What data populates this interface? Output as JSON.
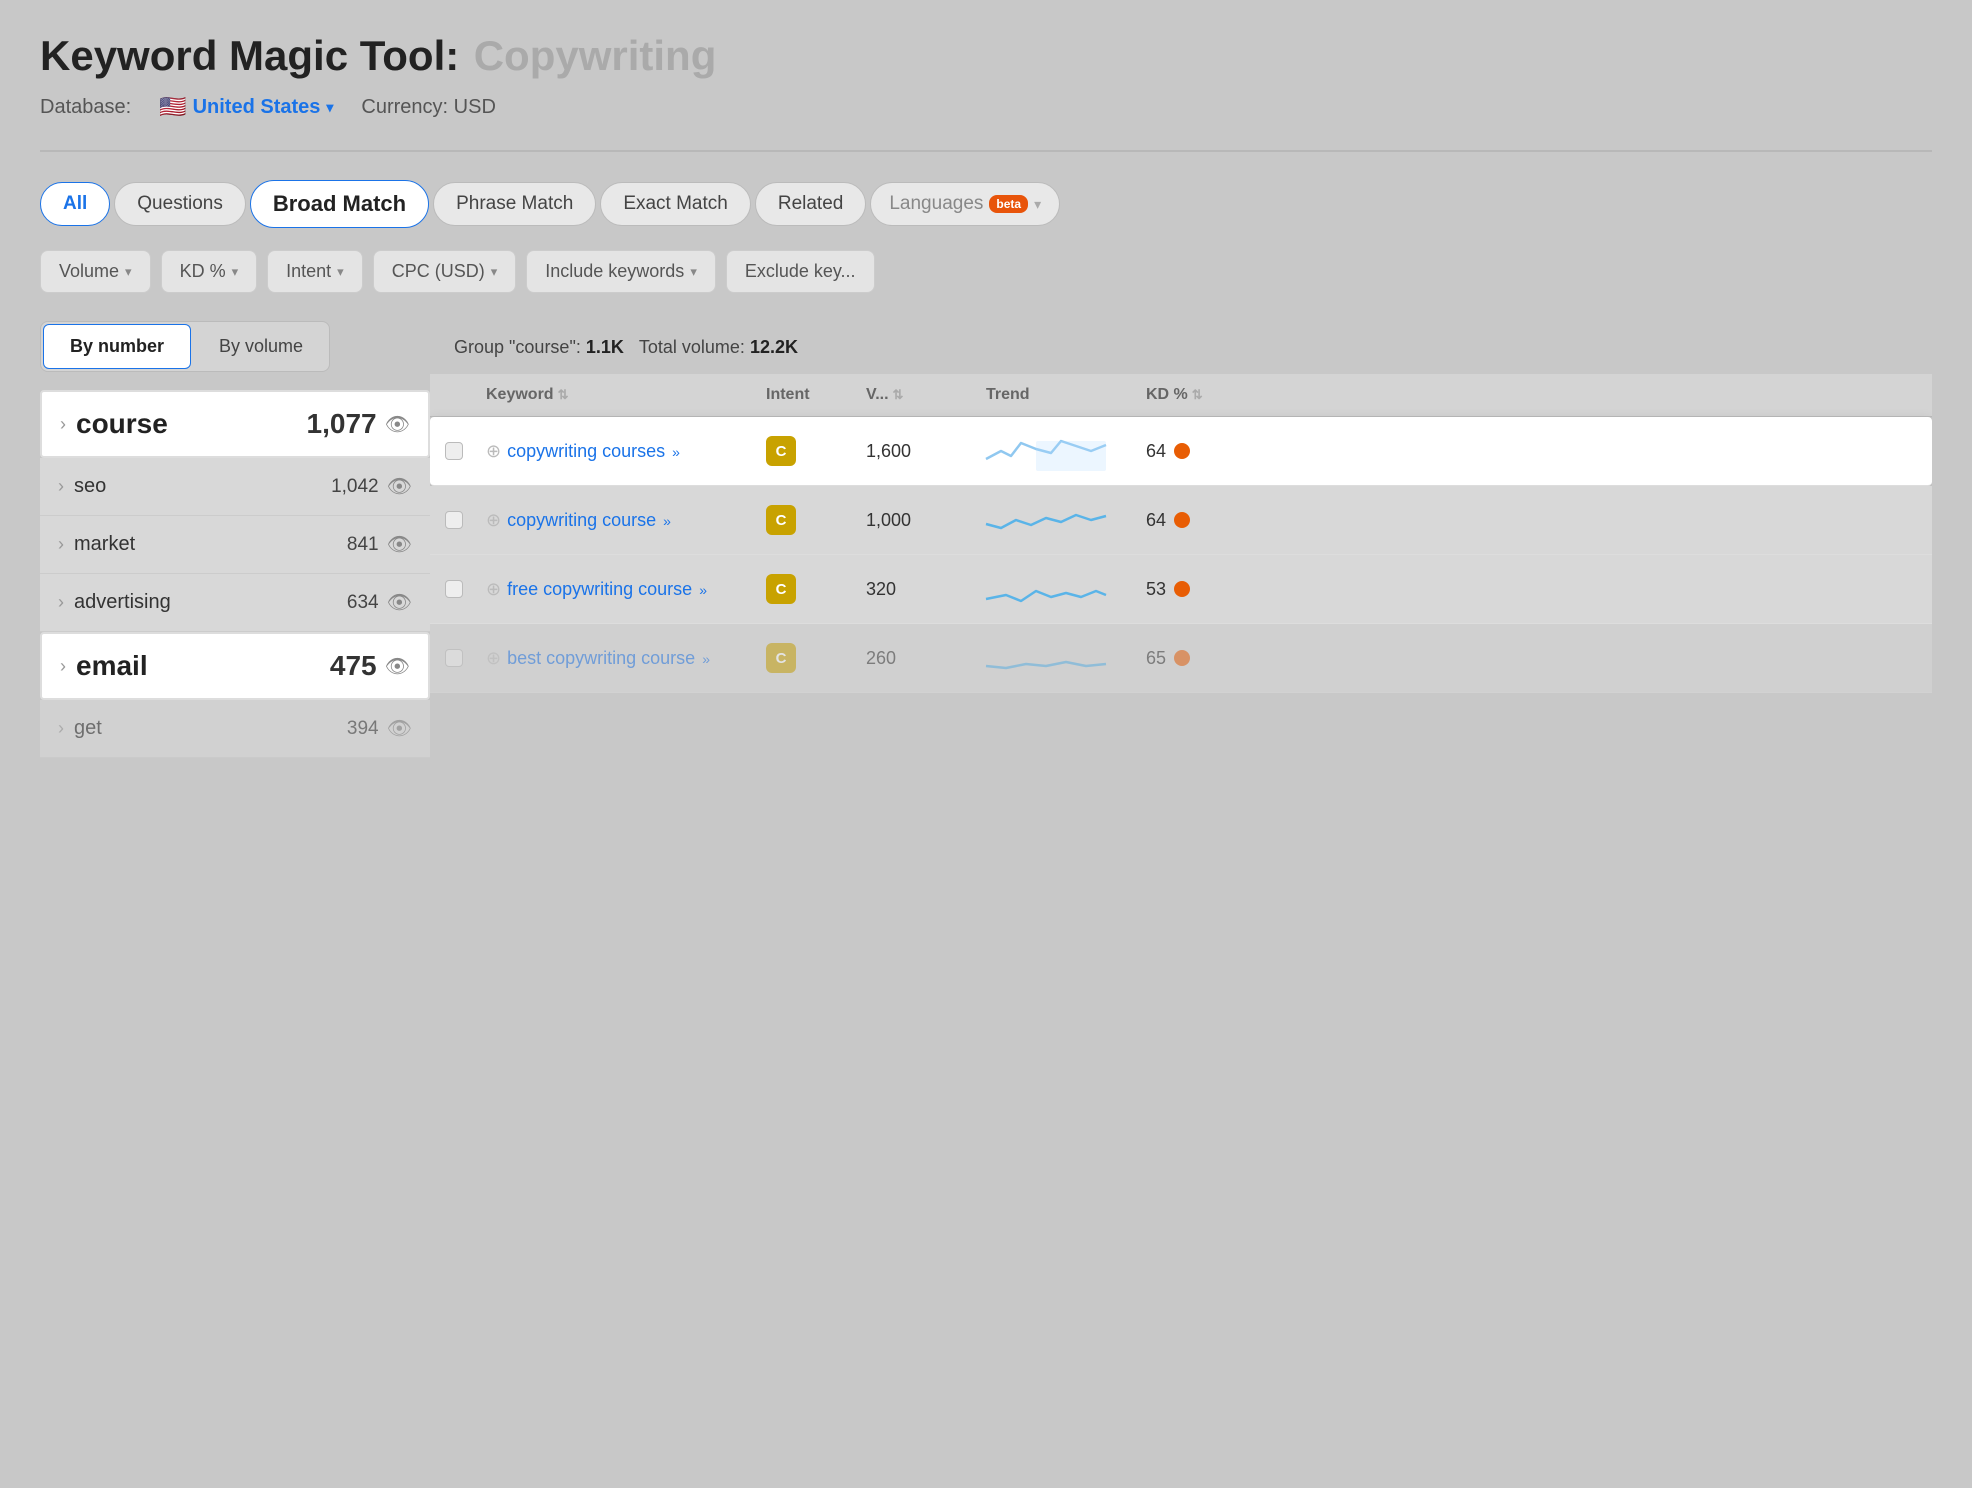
{
  "title": {
    "main": "Keyword Magic Tool:",
    "query": "Copywriting"
  },
  "database": {
    "label": "Database:",
    "country": "United States",
    "currency": "Currency: USD"
  },
  "tabs": [
    {
      "id": "all",
      "label": "All",
      "active": true
    },
    {
      "id": "questions",
      "label": "Questions",
      "active": false
    },
    {
      "id": "broad-match",
      "label": "Broad Match",
      "active": false,
      "selected": true
    },
    {
      "id": "phrase-match",
      "label": "Phrase Match",
      "active": false
    },
    {
      "id": "exact-match",
      "label": "Exact Match",
      "active": false
    },
    {
      "id": "related",
      "label": "Related",
      "active": false
    },
    {
      "id": "languages",
      "label": "Languages",
      "active": false,
      "hasBeta": true
    }
  ],
  "filters": [
    {
      "id": "volume",
      "label": "Volume"
    },
    {
      "id": "kd",
      "label": "KD %"
    },
    {
      "id": "intent",
      "label": "Intent"
    },
    {
      "id": "cpc",
      "label": "CPC (USD)"
    },
    {
      "id": "include",
      "label": "Include keywords"
    },
    {
      "id": "exclude",
      "label": "Exclude key..."
    }
  ],
  "sort_buttons": [
    {
      "id": "by-number",
      "label": "By number",
      "active": true
    },
    {
      "id": "by-volume",
      "label": "By volume",
      "active": false
    }
  ],
  "group_info": {
    "group_label": "Group \"course\":",
    "group_count": "1.1K",
    "total_label": "Total volume:",
    "total_count": "12.2K"
  },
  "groups": [
    {
      "id": "course",
      "name": "course",
      "count": "1,077",
      "large": true,
      "active": true
    },
    {
      "id": "seo",
      "name": "seo",
      "count": "1,042",
      "large": false,
      "active": false
    },
    {
      "id": "market",
      "name": "market",
      "count": "841",
      "large": false,
      "active": false
    },
    {
      "id": "advertising",
      "name": "advertising",
      "count": "634",
      "large": false,
      "active": false
    },
    {
      "id": "email",
      "name": "email",
      "count": "475",
      "large": true,
      "active": false,
      "email": true
    },
    {
      "id": "get",
      "name": "get",
      "count": "394",
      "large": false,
      "active": false,
      "partial": true
    }
  ],
  "table": {
    "headers": [
      {
        "id": "check",
        "label": ""
      },
      {
        "id": "keyword",
        "label": "Keyword",
        "sortable": true
      },
      {
        "id": "intent",
        "label": "Intent",
        "sortable": false
      },
      {
        "id": "volume",
        "label": "V...",
        "sortable": true
      },
      {
        "id": "trend",
        "label": "Trend",
        "sortable": false
      },
      {
        "id": "kd",
        "label": "KD %",
        "sortable": true
      }
    ],
    "rows": [
      {
        "id": "row1",
        "highlighted": true,
        "keyword": "copywriting courses",
        "intent": "C",
        "volume": "1,600",
        "kd": 64,
        "trend": "wavy-high"
      },
      {
        "id": "row2",
        "highlighted": false,
        "keyword": "copywriting course",
        "intent": "C",
        "volume": "1,000",
        "kd": 64,
        "trend": "wavy-mid"
      },
      {
        "id": "row3",
        "highlighted": false,
        "keyword": "free copywriting course",
        "intent": "C",
        "volume": "320",
        "kd": 53,
        "trend": "wavy-low"
      },
      {
        "id": "row4",
        "highlighted": false,
        "keyword": "best copywriting course",
        "intent": "C",
        "volume": "260",
        "kd": 65,
        "trend": "wavy-flat"
      }
    ]
  }
}
